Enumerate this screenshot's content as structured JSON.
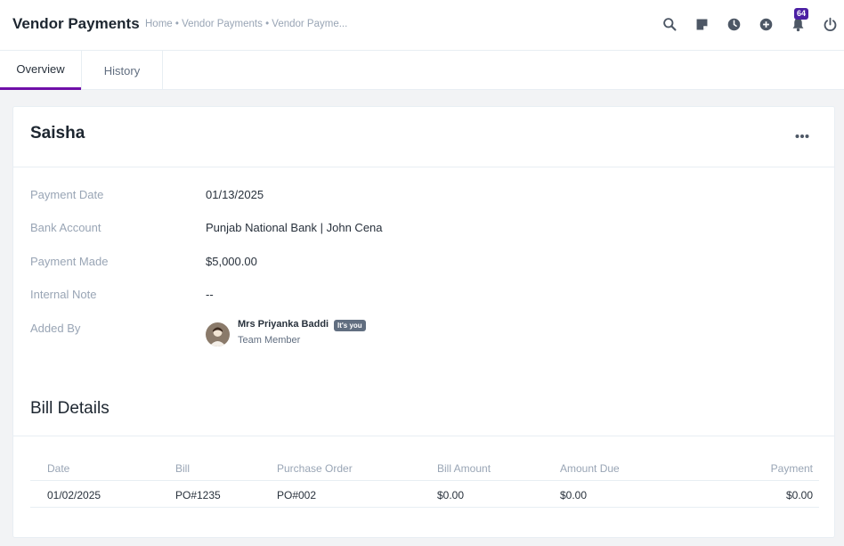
{
  "header": {
    "title": "Vendor Payments",
    "breadcrumb": "Home • Vendor Payments • Vendor Payme...",
    "notification_count": "64",
    "icons": [
      "search-icon",
      "sticky-note-icon",
      "clock-icon",
      "add-circle-icon",
      "bell-icon",
      "power-icon"
    ]
  },
  "tabs": [
    {
      "label": "Overview",
      "active": true
    },
    {
      "label": "History",
      "active": false
    }
  ],
  "vendor": {
    "name": "Saisha"
  },
  "details": [
    {
      "label": "Payment Date",
      "value": "01/13/2025"
    },
    {
      "label": "Bank Account",
      "value": "Punjab National Bank | John Cena"
    },
    {
      "label": "Payment Made",
      "value": "$5,000.00"
    },
    {
      "label": "Internal Note",
      "value": "--"
    },
    {
      "label": "Added By",
      "value": ""
    }
  ],
  "added_by": {
    "name": "Mrs Priyanka Baddi",
    "badge": "It's you",
    "role": "Team Member"
  },
  "bill_details": {
    "title": "Bill Details",
    "columns": [
      "Date",
      "Bill",
      "Purchase Order",
      "Bill Amount",
      "Amount Due",
      "Payment"
    ],
    "rows": [
      [
        "01/02/2025",
        "PO#1235",
        "PO#002",
        "$0.00",
        "$0.00",
        "$0.00"
      ]
    ]
  },
  "colors": {
    "accent": "#6f0fa8",
    "badge": "#4b1fa3"
  }
}
